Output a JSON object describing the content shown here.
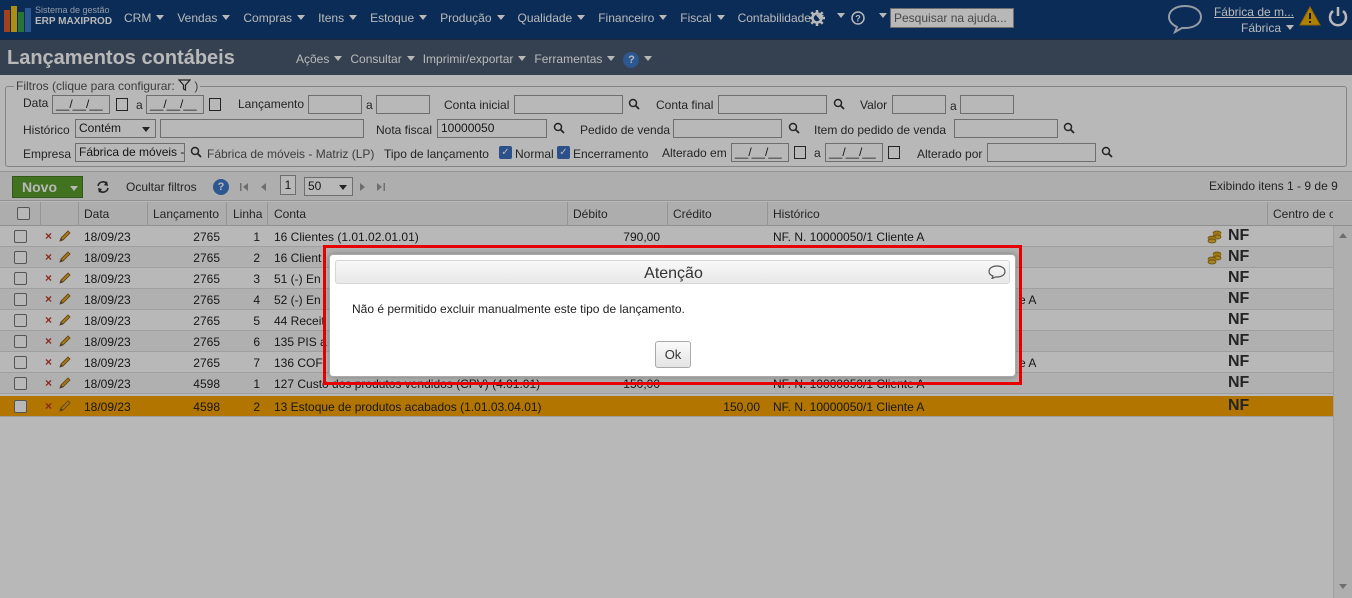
{
  "app": {
    "brand_line1": "Sistema de gestão",
    "brand_line2": "ERP MAXIPROD"
  },
  "nav": {
    "items": [
      "CRM",
      "Vendas",
      "Compras",
      "Itens",
      "Estoque",
      "Produção",
      "Qualidade",
      "Financeiro",
      "Fiscal",
      "Contabilidade"
    ],
    "help_search_placeholder": "Pesquisar na ajuda...",
    "company_name": "Fábrica de m...",
    "company_unit": "Fábrica"
  },
  "titlebar": {
    "title": "Lançamentos contábeis",
    "menu": [
      "Ações",
      "Consultar",
      "Imprimir/exportar",
      "Ferramentas"
    ]
  },
  "filters": {
    "legend": "Filtros (clique para configurar:",
    "legend_close": ")",
    "data_label": "Data",
    "a_label": "a",
    "date_placeholder": "__/__/__",
    "lancamento_label": "Lançamento",
    "conta_inicial_label": "Conta inicial",
    "conta_final_label": "Conta final",
    "valor_label": "Valor",
    "historico_label": "Histórico",
    "historico_op": "Contém",
    "nota_fiscal_label": "Nota fiscal",
    "nota_fiscal_value": "10000050",
    "pedido_venda_label": "Pedido de venda",
    "item_pedido_label": "Item do pedido de venda",
    "empresa_label": "Empresa",
    "empresa_value": "Fábrica de móveis -",
    "empresa_desc": "Fábrica de móveis - Matriz (LP)",
    "tipo_label": "Tipo de lançamento",
    "tipo_normal": "Normal",
    "tipo_encerramento": "Encerramento",
    "alterado_em_label": "Alterado em",
    "alterado_por_label": "Alterado por"
  },
  "toolbar": {
    "novo_label": "Novo",
    "ocultar_filtros": "Ocultar filtros",
    "page": "1",
    "page_size": "50",
    "exibindo": "Exibindo itens 1 - 9 de 9"
  },
  "grid": {
    "columns": [
      "Data",
      "Lançamento",
      "Linha",
      "Conta",
      "Débito",
      "Crédito",
      "Histórico",
      "Centro de c"
    ],
    "nf_label": "NF",
    "rows": [
      {
        "data": "18/09/23",
        "lancamento": "2765",
        "linha": "1",
        "conta": "16 Clientes (1.01.02.01.01)",
        "debito": "790,00",
        "credito": "",
        "historico": "NF. N. 10000050/1 Cliente A"
      },
      {
        "data": "18/09/23",
        "lancamento": "2765",
        "linha": "2",
        "conta": "16 Client",
        "debito": "",
        "credito": "",
        "historico": ""
      },
      {
        "data": "18/09/23",
        "lancamento": "2765",
        "linha": "3",
        "conta": "51 (-) En",
        "debito": "",
        "credito": "",
        "historico": ""
      },
      {
        "data": "18/09/23",
        "lancamento": "2765",
        "linha": "4",
        "conta": "52 (-) En",
        "debito": "",
        "credito": "",
        "historico": "e A"
      },
      {
        "data": "18/09/23",
        "lancamento": "2765",
        "linha": "5",
        "conta": "44 Receit",
        "debito": "",
        "credito": "",
        "historico": ""
      },
      {
        "data": "18/09/23",
        "lancamento": "2765",
        "linha": "6",
        "conta": "135 PIS a",
        "debito": "",
        "credito": "",
        "historico": ""
      },
      {
        "data": "18/09/23",
        "lancamento": "2765",
        "linha": "7",
        "conta": "136 COFI",
        "debito": "",
        "credito": "",
        "historico": "e A"
      },
      {
        "data": "18/09/23",
        "lancamento": "4598",
        "linha": "1",
        "conta": "127 Custo dos produtos vendidos (CPV) (4.01.01)",
        "debito": "150,00",
        "credito": "",
        "historico": "NF. N. 10000050/1 Cliente A"
      },
      {
        "data": "18/09/23",
        "lancamento": "4598",
        "linha": "2",
        "conta": "13 Estoque de produtos acabados (1.01.03.04.01)",
        "debito": "",
        "credito": "150,00",
        "historico": "NF. N. 10000050/1 Cliente A"
      }
    ]
  },
  "dialog": {
    "title": "Atenção",
    "message": "Não é permitido excluir manualmente este tipo de lançamento.",
    "ok_label": "Ok"
  },
  "colors": {
    "nav_bg": "#0e3e79",
    "titlebar_bg": "#4a5b6f",
    "selected_row": "#f5a300",
    "novo_green": "#5a9e2c",
    "highlight_red": "#e60000"
  }
}
